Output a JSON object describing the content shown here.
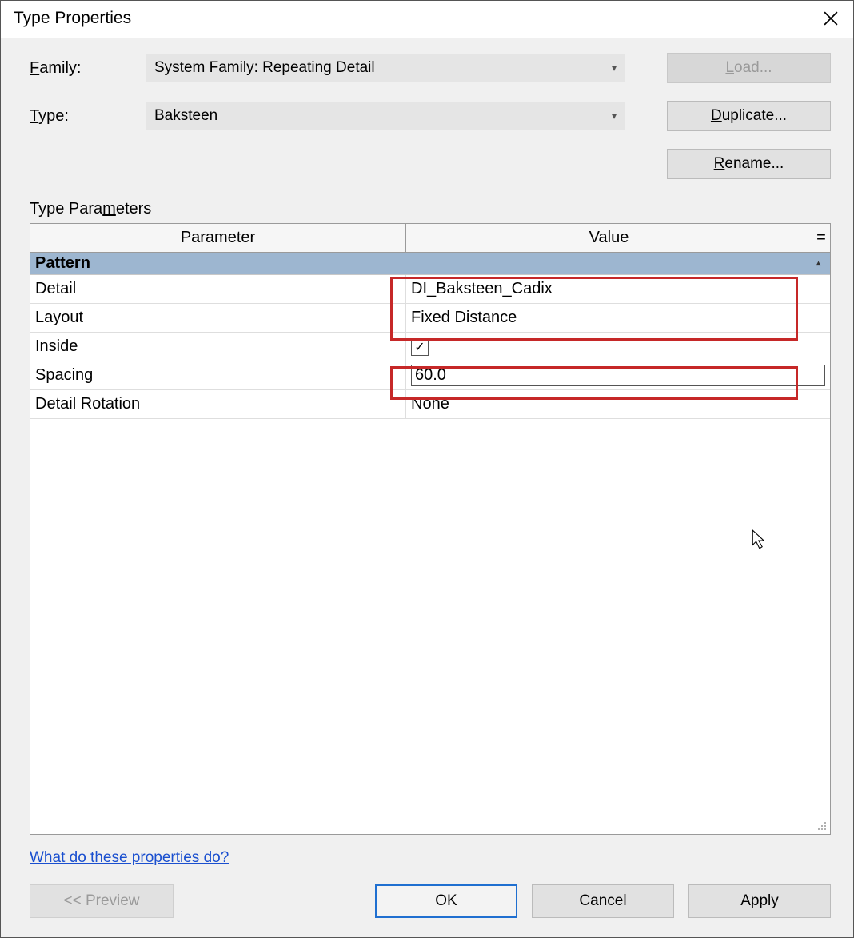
{
  "window": {
    "title": "Type Properties"
  },
  "labels": {
    "family_prefix": "F",
    "family_rest": "amily:",
    "type_prefix": "T",
    "type_rest": "ype:",
    "type_params_prefix": "Type Para",
    "type_params_underline": "m",
    "type_params_rest": "eters"
  },
  "dropdowns": {
    "family": "System Family: Repeating Detail",
    "type": "Baksteen"
  },
  "buttons": {
    "load_prefix": "L",
    "load_rest": "oad...",
    "duplicate_prefix": "D",
    "duplicate_rest": "uplicate...",
    "rename_prefix": "R",
    "rename_rest": "ename...",
    "preview_prefix": "<<  P",
    "preview_rest": "review",
    "ok": "OK",
    "cancel": "Cancel",
    "apply": "Apply"
  },
  "table": {
    "header_param": "Parameter",
    "header_value": "Value",
    "header_eq": "=",
    "group": "Pattern",
    "rows": {
      "detail_label": "Detail",
      "detail_value": "DI_Baksteen_Cadix",
      "layout_label": "Layout",
      "layout_value": "Fixed Distance",
      "inside_label": "Inside",
      "inside_checked": "✓",
      "spacing_label": "Spacing",
      "spacing_value": "60.0",
      "rotation_label": "Detail Rotation",
      "rotation_value": "None"
    }
  },
  "help_link": "What do these properties do?"
}
